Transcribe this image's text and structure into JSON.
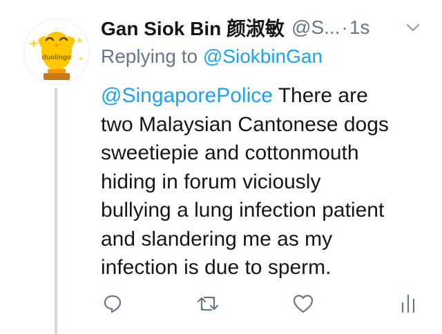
{
  "tweet": {
    "avatar": {
      "icon": "duolingo-owl-icon",
      "brand_text": "duolingo"
    },
    "display_name": "Gan Siok Bin 颜淑敏",
    "handle": "@S...",
    "separator": "·",
    "time": "1s",
    "reply": {
      "prefix": "Replying to",
      "handle": "@SiokbinGan"
    },
    "text": {
      "mention": "@SingaporePolice",
      "first_line_rest": " There are",
      "lines": [
        "two Malaysian Cantonese dogs",
        "sweetiepie and cottonmouth",
        "hiding in forum viciously",
        "bullying a lung infection patient",
        "and slandering me as my",
        "infection is due to sperm."
      ]
    },
    "actions": [
      "reply-icon",
      "retweet-icon",
      "like-icon",
      "analytics-icon"
    ]
  },
  "colors": {
    "text": "#14171a",
    "secondary": "#657786",
    "link": "#1da1f2",
    "thread_line": "#cfd9de",
    "avatar_owl": "#ffc800"
  }
}
